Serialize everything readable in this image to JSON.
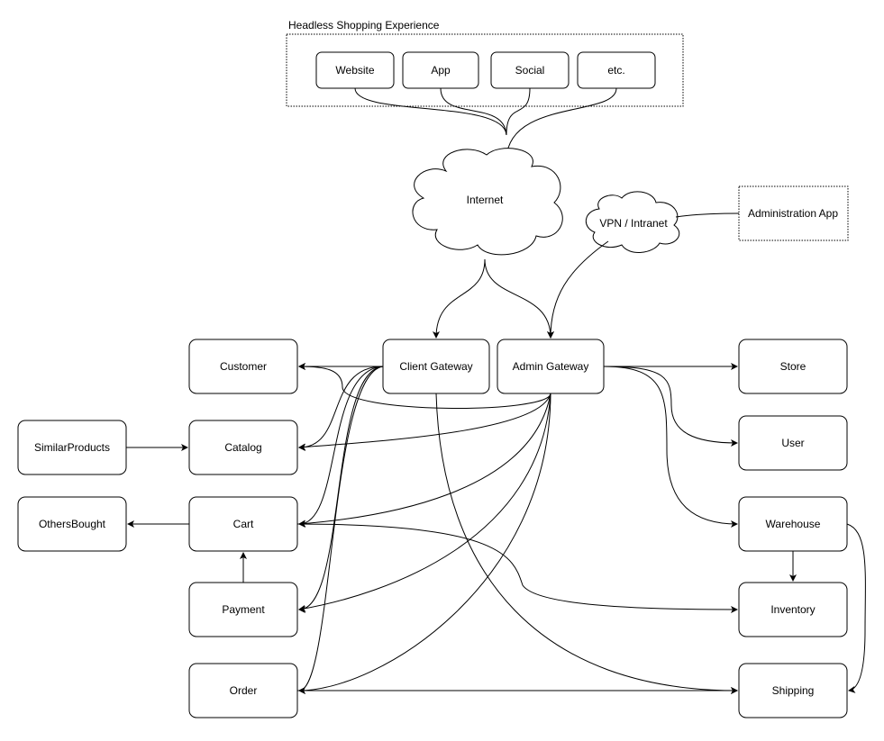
{
  "container": {
    "label": "Headless Shopping Experience"
  },
  "channels": [
    "Website",
    "App",
    "Social",
    "etc."
  ],
  "clouds": {
    "internet": "Internet",
    "vpn": "VPN / Intranet"
  },
  "admin_app": "Administration App",
  "gateways": {
    "client": "Client Gateway",
    "admin": "Admin Gateway"
  },
  "left_services": [
    "Customer",
    "Catalog",
    "Cart",
    "Payment",
    "Order"
  ],
  "aux_services": [
    "SimilarProducts",
    "OthersBought"
  ],
  "right_services": [
    "Store",
    "User",
    "Warehouse",
    "Inventory",
    "Shipping"
  ]
}
